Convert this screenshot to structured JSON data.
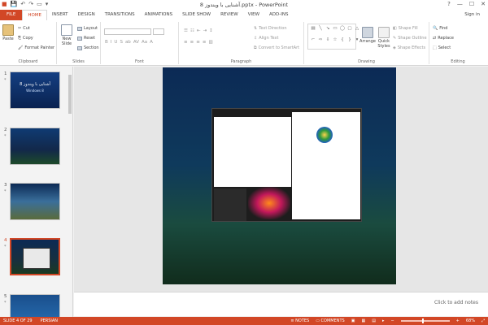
{
  "title_bar": {
    "document_title": "آشنایی با ویندوز 8.pptx - PowerPoint"
  },
  "window_controls": {
    "help": "?",
    "minimize": "—",
    "maximize": "☐",
    "close": "✕"
  },
  "tabs": [
    "FILE",
    "HOME",
    "INSERT",
    "DESIGN",
    "TRANSITIONS",
    "ANIMATIONS",
    "SLIDE SHOW",
    "REVIEW",
    "VIEW",
    "ADD-INS"
  ],
  "account": {
    "sign_in": "Sign in"
  },
  "ribbon": {
    "clipboard": {
      "label": "Clipboard",
      "paste": "Paste",
      "cut": "Cut",
      "copy": "Copy",
      "format_painter": "Format Painter"
    },
    "slides": {
      "label": "Slides",
      "new_slide": "New Slide",
      "layout": "Layout",
      "reset": "Reset",
      "section": "Section"
    },
    "font": {
      "label": "Font"
    },
    "paragraph": {
      "label": "Paragraph",
      "text_direction": "Text Direction",
      "align_text": "Align Text",
      "convert_smartart": "Convert to SmartArt"
    },
    "drawing": {
      "label": "Drawing",
      "arrange": "Arrange",
      "quick_styles": "Quick Styles",
      "shape_fill": "Shape Fill",
      "shape_outline": "Shape Outline",
      "shape_effects": "Shape Effects"
    },
    "editing": {
      "label": "Editing",
      "find": "Find",
      "replace": "Replace",
      "select": "Select"
    }
  },
  "thumbnails": [
    {
      "number": "1",
      "title": "آشنایی با ویندوز 8",
      "subtitle": "Windows 8"
    },
    {
      "number": "2",
      "title": "",
      "subtitle": ""
    },
    {
      "number": "3",
      "title": "",
      "subtitle": ""
    },
    {
      "number": "4",
      "title": "",
      "subtitle": ""
    },
    {
      "number": "5",
      "title": "",
      "subtitle": ""
    }
  ],
  "notes": {
    "placeholder": "Click to add notes"
  },
  "status": {
    "slide_info": "SLIDE 4 OF 29",
    "language": "PERSIAN",
    "notes": "NOTES",
    "comments": "COMMENTS",
    "zoom": "68%"
  },
  "colors": {
    "accent": "#d24726",
    "ribbon_bg": "#ffffff",
    "app_bg": "#f3f3f3"
  }
}
